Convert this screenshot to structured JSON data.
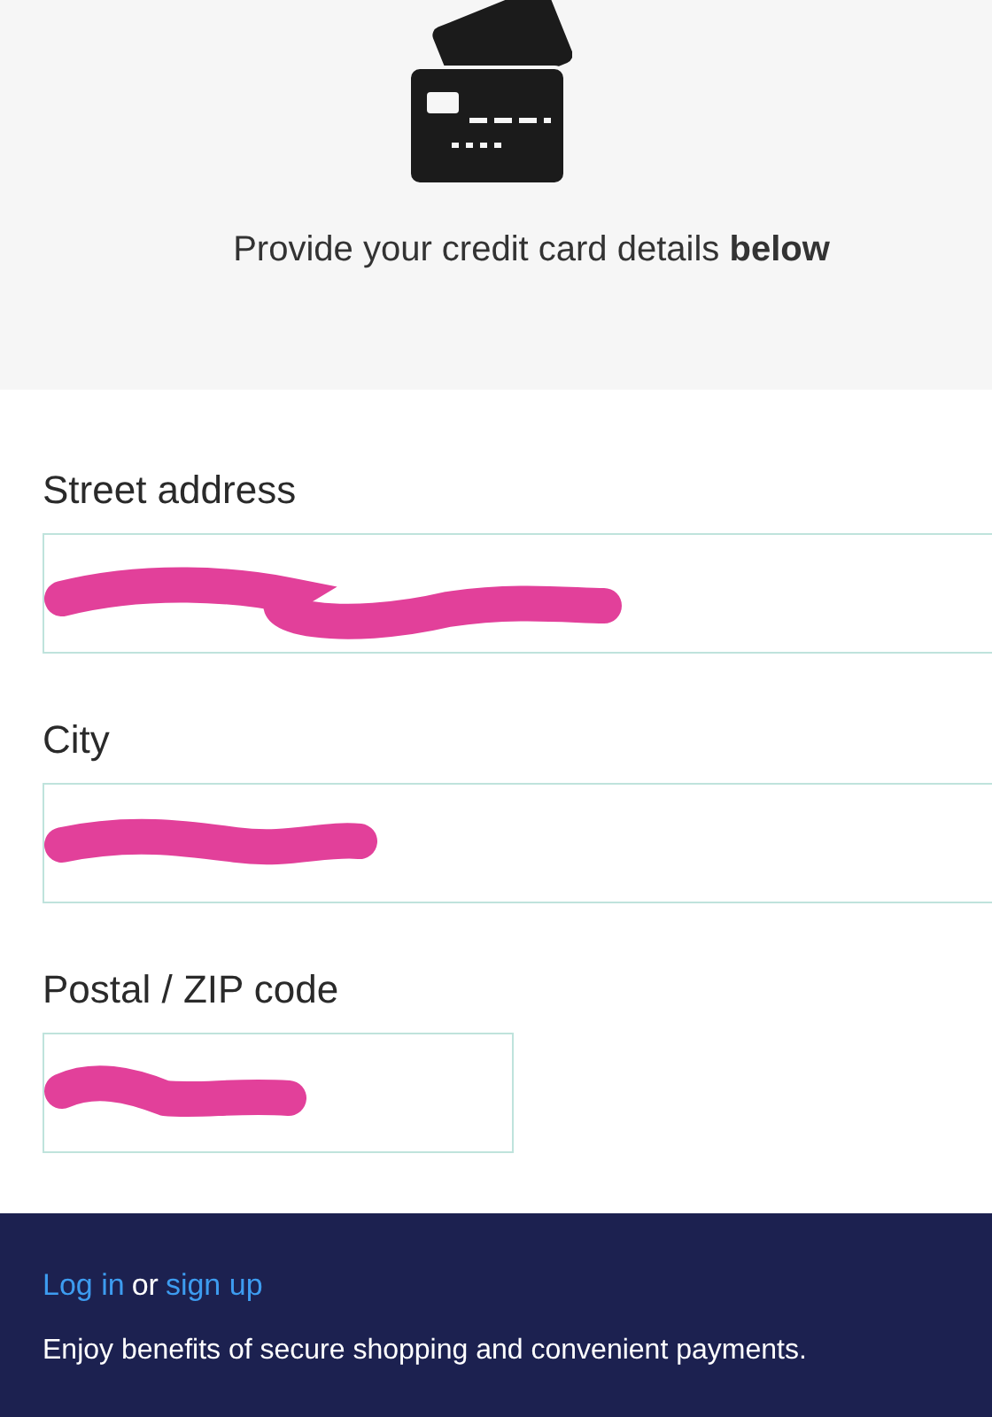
{
  "header": {
    "message": "Provide your credit card details **below**"
  },
  "fields": [
    {
      "label": "Street address",
      "kind": "full",
      "redacted": true
    },
    {
      "label": "City",
      "kind": "full",
      "redacted": true
    },
    {
      "label": "Postal / ZIP code",
      "kind": "short",
      "redacted": true
    }
  ],
  "footer": {
    "login": "Log in",
    "connector": "or",
    "signup": "sign up",
    "tagline": "Enjoy benefits of secure shopping and convenient payments."
  }
}
